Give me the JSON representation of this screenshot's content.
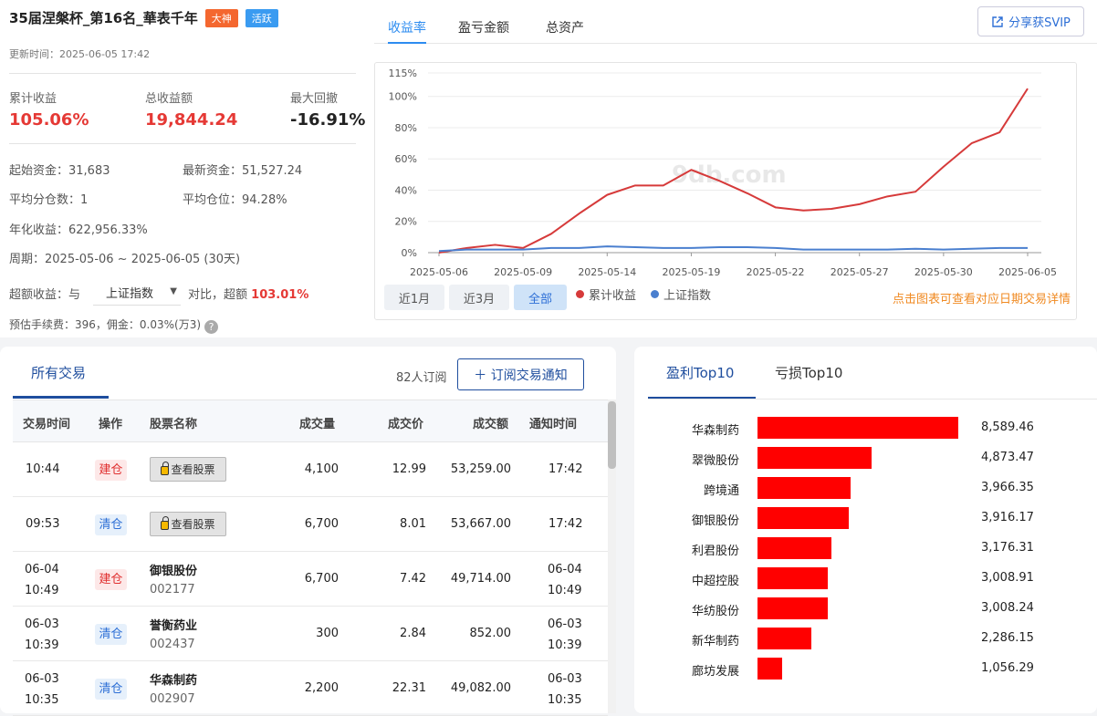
{
  "header": {
    "title": "35届涅槃杯_第16名_華表千年",
    "badges": [
      {
        "label": "大神",
        "color": "#f4672f"
      },
      {
        "label": "活跃",
        "color": "#3a9bf1"
      }
    ],
    "update_time": "更新时间：2025-06-05 17:42"
  },
  "stats": [
    {
      "label": "累计收益",
      "value": "105.06%",
      "color": "#e53935"
    },
    {
      "label": "总收益额",
      "value": "19,844.24",
      "color": "#e53935"
    },
    {
      "label": "最大回撤",
      "value": "-16.91%",
      "color": "#222222"
    }
  ],
  "info": {
    "start_capital": "起始资金：31,683",
    "latest_capital": "最新资金：51,527.24",
    "avg_split": "平均分仓数：1",
    "avg_position": "平均仓位：94.28%",
    "annual_return": "年化收益：622,956.33%",
    "period": "周期：2025-05-06 ~ 2025-06-05 (30天)",
    "excess_prefix": "超额收益：与",
    "excess_select": "上证指数",
    "excess_mid": "对比，超额",
    "excess_value": "103.01%",
    "fee": "预估手续费：396，佣金：0.03%(万3)",
    "help_icon": "?"
  },
  "chart_tabs": [
    "收益率",
    "盈亏金额",
    "总资产"
  ],
  "share_button": "分享获SVIP",
  "range_buttons": [
    "近1月",
    "近3月",
    "全部"
  ],
  "watermark": "9db.com",
  "hint": "点击图表可查看对应日期交易详情",
  "chart_data": {
    "type": "line",
    "x": [
      "2025-05-06",
      "2025-05-07",
      "2025-05-08",
      "2025-05-09",
      "2025-05-12",
      "2025-05-13",
      "2025-05-14",
      "2025-05-15",
      "2025-05-16",
      "2025-05-19",
      "2025-05-20",
      "2025-05-21",
      "2025-05-22",
      "2025-05-23",
      "2025-05-26",
      "2025-05-27",
      "2025-05-28",
      "2025-05-29",
      "2025-05-30",
      "2025-06-03",
      "2025-06-04",
      "2025-06-05"
    ],
    "x_ticks": [
      "2025-05-06",
      "2025-05-09",
      "2025-05-14",
      "2025-05-19",
      "2025-05-22",
      "2025-05-27",
      "2025-05-30",
      "2025-06-05"
    ],
    "y_ticks": [
      "0%",
      "20%",
      "40%",
      "60%",
      "80%",
      "100%",
      "115%"
    ],
    "ylim": [
      0,
      115
    ],
    "series": [
      {
        "name": "累计收益",
        "color": "#d63a3a",
        "values": [
          0,
          3,
          5,
          3,
          12,
          25,
          37,
          43,
          43,
          53,
          46,
          38,
          29,
          27,
          28,
          31,
          36,
          39,
          55,
          70,
          77,
          105
        ]
      },
      {
        "name": "上证指数",
        "color": "#4a7fcf",
        "values": [
          1,
          2,
          2,
          2,
          3,
          3,
          4,
          3.5,
          3,
          3,
          3.5,
          3.5,
          3,
          2,
          2,
          2,
          2,
          2.5,
          2,
          2.5,
          3,
          3
        ]
      }
    ]
  },
  "trades": {
    "tabs": [
      "所有交易"
    ],
    "subscribers": "82人订阅",
    "subscribe_button": "＋ 订阅交易通知",
    "columns": [
      "交易时间",
      "操作",
      "股票名称",
      "成交量",
      "成交价",
      "成交额",
      "通知时间"
    ],
    "lock_label": "查看股票",
    "rows": [
      {
        "time1": "10:44",
        "time2": "",
        "op": "建仓",
        "type": "build",
        "locked": true,
        "name": "",
        "code": "",
        "qty": "4,100",
        "price": "12.99",
        "amount": "53,259.00",
        "n1": "17:42",
        "n2": ""
      },
      {
        "time1": "09:53",
        "time2": "",
        "op": "清仓",
        "type": "clear",
        "locked": true,
        "name": "",
        "code": "",
        "qty": "6,700",
        "price": "8.01",
        "amount": "53,667.00",
        "n1": "17:42",
        "n2": ""
      },
      {
        "time1": "06-04",
        "time2": "10:49",
        "op": "建仓",
        "type": "build",
        "locked": false,
        "name": "御银股份",
        "code": "002177",
        "qty": "6,700",
        "price": "7.42",
        "amount": "49,714.00",
        "n1": "06-04",
        "n2": "10:49"
      },
      {
        "time1": "06-03",
        "time2": "10:39",
        "op": "清仓",
        "type": "clear",
        "locked": false,
        "name": "誉衡药业",
        "code": "002437",
        "qty": "300",
        "price": "2.84",
        "amount": "852.00",
        "n1": "06-03",
        "n2": "10:39"
      },
      {
        "time1": "06-03",
        "time2": "10:35",
        "op": "清仓",
        "type": "clear",
        "locked": false,
        "name": "华森制药",
        "code": "002907",
        "qty": "2,200",
        "price": "22.31",
        "amount": "49,082.00",
        "n1": "06-03",
        "n2": "10:35"
      }
    ]
  },
  "top10": {
    "tabs": [
      "盈利Top10",
      "亏损Top10"
    ],
    "bar_color": "#ff0000",
    "chart_data": {
      "type": "bar",
      "categories": [
        "华森制药",
        "翠微股份",
        "跨境通",
        "御银股份",
        "利君股份",
        "中超控股",
        "华纺股份",
        "新华制药",
        "廊坊发展"
      ],
      "values": [
        8589.46,
        4873.47,
        3966.35,
        3916.17,
        3176.31,
        3008.91,
        3008.24,
        2286.15,
        1056.29
      ],
      "labels": [
        "8,589.46",
        "4,873.47",
        "3,966.35",
        "3,916.17",
        "3,176.31",
        "3,008.91",
        "3,008.24",
        "2,286.15",
        "1,056.29"
      ]
    }
  }
}
